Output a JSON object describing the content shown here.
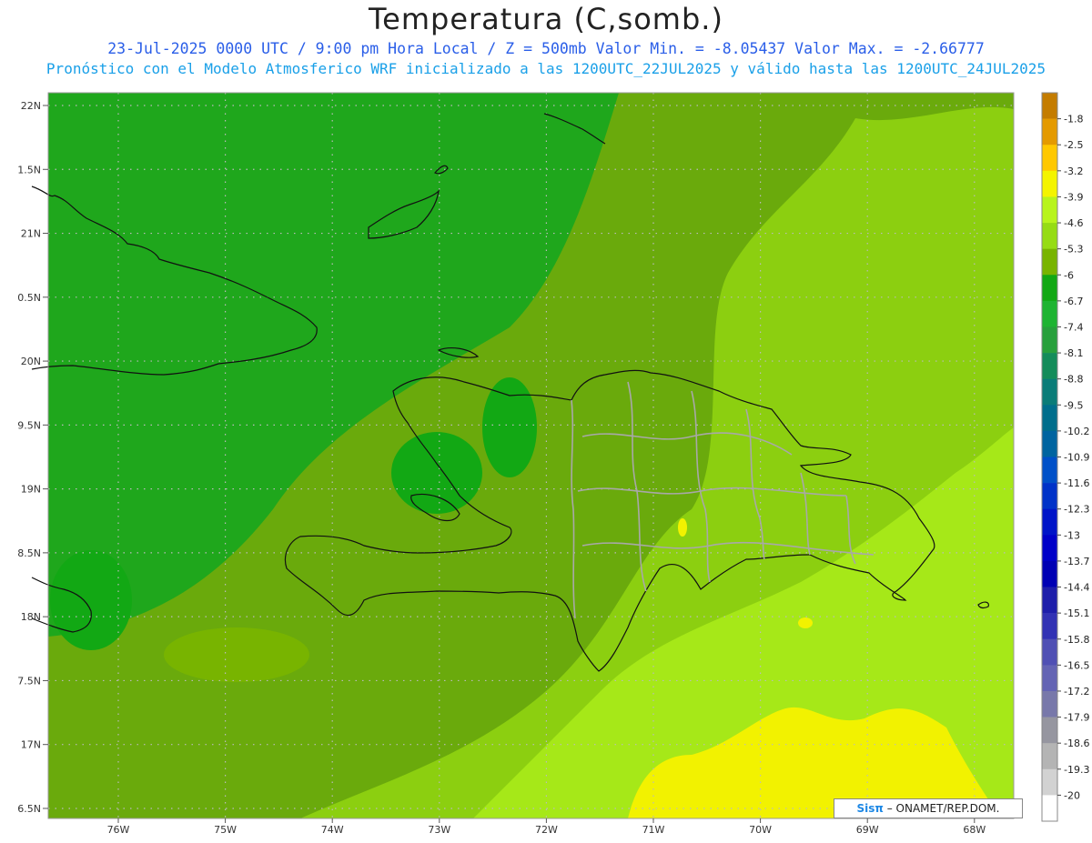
{
  "header": {
    "title": "Temperatura (C,somb.)",
    "line1": "23-Jul-2025   0000 UTC / 9:00 pm Hora Local / Z = 500mb  Valor Min. = -8.05437  Valor Max. = -2.66777",
    "line2": "Pronóstico con el Modelo Atmosferico WRF inicializado a las 1200UTC_22JUL2025 y válido hasta las  1200UTC_24JUL2025"
  },
  "axes": {
    "lon_labels": [
      "76W",
      "75W",
      "74W",
      "73W",
      "72W",
      "71W",
      "70W",
      "69W",
      "68W"
    ],
    "lat_labels": [
      "22N",
      "1.5N",
      "21N",
      "0.5N",
      "20N",
      "9.5N",
      "19N",
      "8.5N",
      "18N",
      "7.5N",
      "17N",
      "6.5N"
    ]
  },
  "colorbar": {
    "labels": [
      "-1.8",
      "-2.5",
      "-3.2",
      "-3.9",
      "-4.6",
      "-5.3",
      "-6",
      "-6.7",
      "-7.4",
      "-8.1",
      "-8.8",
      "-9.5",
      "-10.2",
      "-10.9",
      "-11.6",
      "-12.3",
      "-13",
      "-13.7",
      "-14.4",
      "-15.1",
      "-15.8",
      "-16.5",
      "-17.2",
      "-17.9",
      "-18.6",
      "-19.3",
      "-20"
    ],
    "colors": [
      "#c47c00",
      "#e49a00",
      "#ffc800",
      "#f4f400",
      "#b8f41c",
      "#96dc14",
      "#78b400",
      "#12a814",
      "#1eb432",
      "#28a03c",
      "#148c5a",
      "#0a7c78",
      "#006e8c",
      "#0064a0",
      "#0050c8",
      "#0032c8",
      "#0014c8",
      "#0000c8",
      "#0000b4",
      "#1e1eaa",
      "#3232b4",
      "#5050b4",
      "#6464b4",
      "#7878aa",
      "#9696a0",
      "#b4b4b4",
      "#d2d2d2",
      "#ffffff"
    ]
  },
  "credit": {
    "logo": "Sisπ",
    "text": " – ONAMET/REP.DOM."
  }
}
